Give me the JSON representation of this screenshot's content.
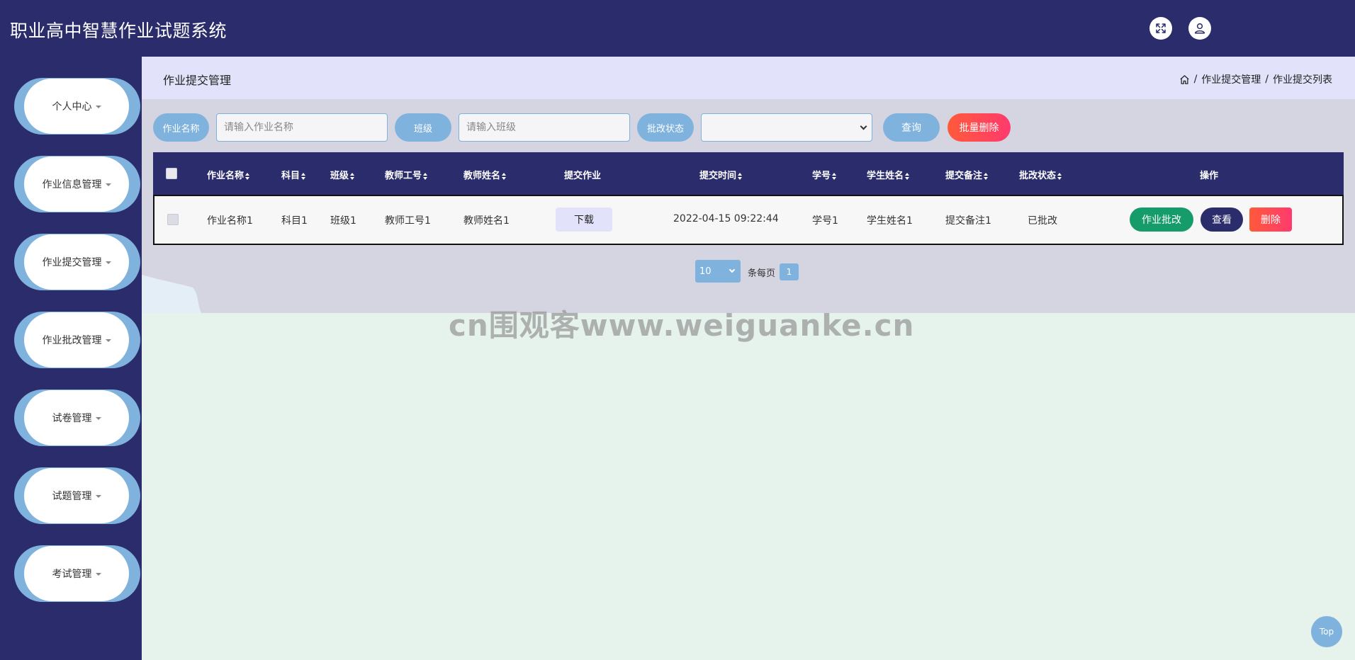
{
  "app": {
    "title": "职业高中智慧作业试题系统"
  },
  "header": {
    "fullscreen_icon": "expand-icon",
    "user_icon": "user-icon"
  },
  "sidebar": {
    "items": [
      {
        "label": "个人中心"
      },
      {
        "label": "作业信息管理"
      },
      {
        "label": "作业提交管理"
      },
      {
        "label": "作业批改管理"
      },
      {
        "label": "试卷管理"
      },
      {
        "label": "试题管理"
      },
      {
        "label": "考试管理"
      }
    ]
  },
  "page": {
    "title": "作业提交管理",
    "breadcrumb": {
      "sep1": "/",
      "item1": "作业提交管理",
      "sep2": "/",
      "item2": "作业提交列表"
    }
  },
  "search": {
    "homework_name_label": "作业名称",
    "homework_name_placeholder": "请输入作业名称",
    "class_label": "班级",
    "class_placeholder": "请输入班级",
    "status_label": "批改状态",
    "status_value": "",
    "query_button": "查询",
    "batch_delete_button": "批量删除"
  },
  "table": {
    "columns": [
      "作业名称",
      "科目",
      "班级",
      "教师工号",
      "教师姓名",
      "提交作业",
      "提交时间",
      "学号",
      "学生姓名",
      "提交备注",
      "批改状态",
      "操作"
    ],
    "rows": [
      {
        "homework_name": "作业名称1",
        "subject": "科目1",
        "class": "班级1",
        "teacher_id": "教师工号1",
        "teacher_name": "教师姓名1",
        "download_label": "下载",
        "submit_time": "2022-04-15 09:22:44",
        "student_id": "学号1",
        "student_name": "学生姓名1",
        "remark": "提交备注1",
        "status": "已批改",
        "actions": {
          "review": "作业批改",
          "view": "查看",
          "delete": "删除"
        }
      }
    ]
  },
  "pagination": {
    "page_size": "10",
    "per_page_label": "条每页",
    "current_page": "1"
  },
  "watermark": "cn围观客www.weiguanke.cn",
  "back_to_top": "Top",
  "colors": {
    "navy": "#2a2c6c",
    "accent_blue": "#7fb2dd",
    "header_lavender": "#e2e2fb",
    "success": "#169b6b",
    "danger": "#ff3a6e"
  }
}
